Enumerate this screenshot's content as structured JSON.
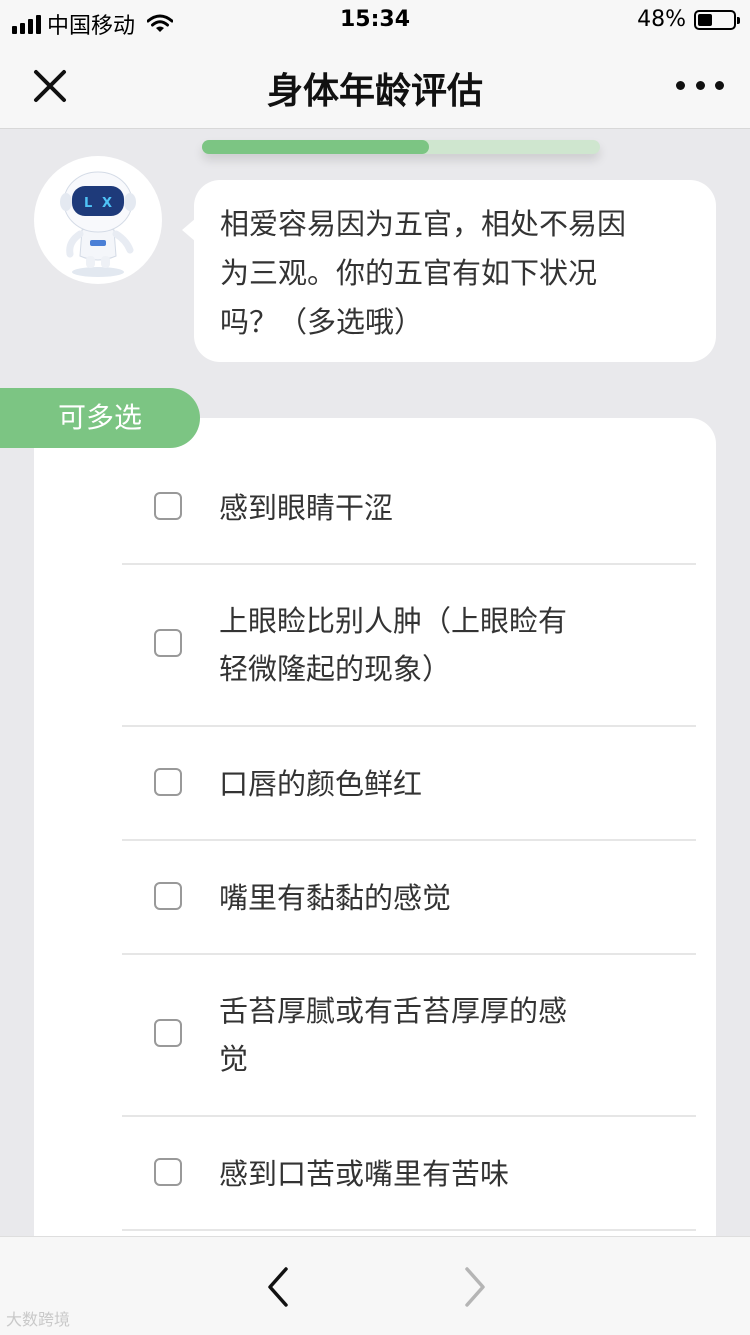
{
  "status_bar": {
    "carrier": "中国移动",
    "time": "15:34",
    "battery_percent_text": "48%",
    "battery_level": 0.48
  },
  "nav": {
    "title": "身体年龄评估",
    "close_icon": "close-icon",
    "more_icon": "more-icon"
  },
  "progress": {
    "value": 0.57
  },
  "question": {
    "lines": [
      "相爱容易因为五官，相处不易因",
      "为三观。你的五官有如下状况",
      "吗？（多选哦）"
    ]
  },
  "tag": {
    "label": "可多选"
  },
  "options": [
    {
      "lines": [
        "感到眼睛干涩"
      ],
      "checked": false
    },
    {
      "lines": [
        "上眼睑比别人肿（上眼睑有",
        "轻微隆起的现象）"
      ],
      "checked": false
    },
    {
      "lines": [
        "口唇的颜色鲜红"
      ],
      "checked": false
    },
    {
      "lines": [
        "嘴里有黏黏的感觉"
      ],
      "checked": false
    },
    {
      "lines": [
        "舌苔厚腻或有舌苔厚厚的感",
        "觉"
      ],
      "checked": false
    },
    {
      "lines": [
        "感到口苦或嘴里有苦味"
      ],
      "checked": false
    }
  ],
  "bottom_nav": {
    "back_icon": "chevron-left-icon",
    "forward_icon": "chevron-right-icon"
  },
  "watermark": {
    "text": "大数跨境"
  },
  "colors": {
    "accent": "#7cc583",
    "progress_track": "#cfe6cf",
    "background": "#e9e9ec"
  }
}
